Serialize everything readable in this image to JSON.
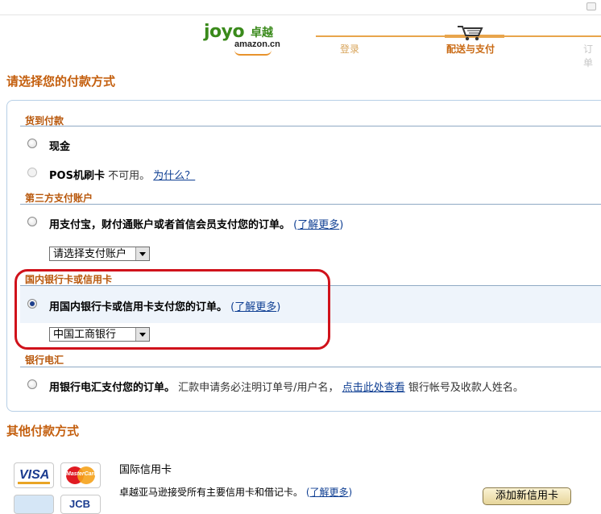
{
  "header": {
    "logo_joyo": "joyo",
    "logo_zhuoyue": "卓越",
    "logo_amazon": "amazon.cn",
    "steps": [
      "登录",
      "配送与支付",
      "订单"
    ]
  },
  "payment_section": {
    "title": "请选择您的付款方式",
    "categories": {
      "cod": "货到付款",
      "third_party": "第三方支付账户",
      "domestic_card": "国内银行卡或信用卡",
      "wire": "银行电汇"
    },
    "options": {
      "cash": "现金",
      "pos_label": "POS机刷卡",
      "pos_unavailable": "不可用。",
      "pos_why": "为什么？",
      "alipay_text": "用支付宝，财付通账户或者首信会员支付您的订单。",
      "alipay_learn": "了解更多",
      "account_select": "请选择支付账户",
      "bank_text": "用国内银行卡或信用卡支付您的订单。",
      "bank_learn": "了解更多",
      "bank_select": "中国工商银行",
      "wire_text": "用银行电汇支付您的订单。",
      "wire_note1": "汇款申请务必注明订单号/用户名，",
      "wire_link": "点击此处查看",
      "wire_note2": "银行帐号及收款人姓名。"
    }
  },
  "other_section": {
    "title": "其他付款方式",
    "intl_title": "国际信用卡",
    "intl_desc": "卓越亚马逊接受所有主要信用卡和借记卡。",
    "intl_learn": "了解更多",
    "add_card_button": "添加新信用卡",
    "card_brands": {
      "visa": "VISA",
      "mastercard": "MasterCard",
      "jcb": "JCB"
    }
  },
  "colors": {
    "accent": "#c45f0e",
    "link": "#0f3f93",
    "highlight_ring": "#d0121b"
  }
}
